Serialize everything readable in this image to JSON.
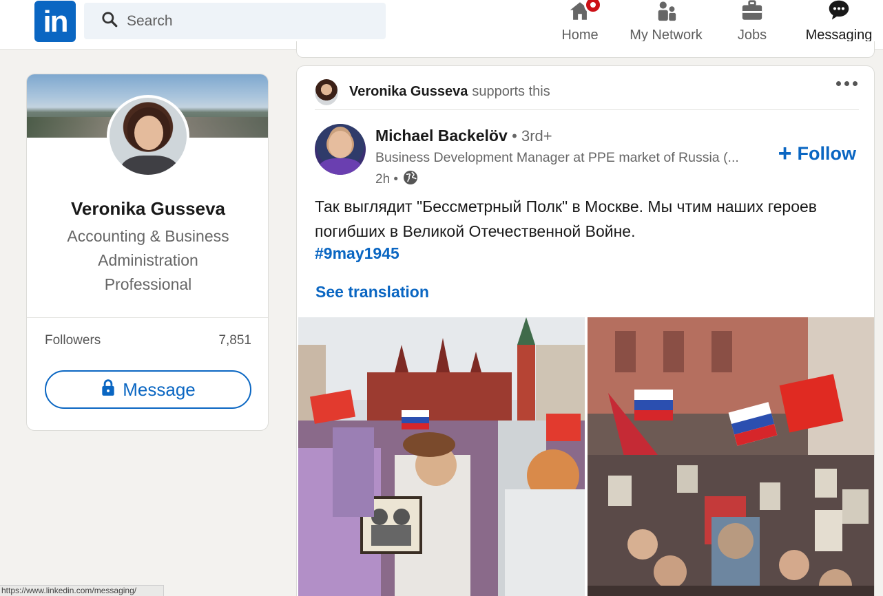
{
  "nav": {
    "logo_text": "in",
    "search": {
      "placeholder": "Search",
      "value": ""
    },
    "items": [
      {
        "label": "Home",
        "icon": "home-icon",
        "has_badge": true
      },
      {
        "label": "My Network",
        "icon": "network-icon"
      },
      {
        "label": "Jobs",
        "icon": "briefcase-icon"
      },
      {
        "label": "Messaging",
        "icon": "messaging-icon"
      }
    ]
  },
  "profile": {
    "name": "Veronika Gusseva",
    "headline": "Accounting & Business Administration Professional",
    "followers_label": "Followers",
    "followers_count": "7,851",
    "message_label": "Message"
  },
  "post": {
    "supporter_name": "Veronika Gusseva",
    "supporter_action": "supports this",
    "author": {
      "name": "Michael Backelöv",
      "degree": "• 3rd+",
      "headline": "Business Development Manager at PPE market of Russia (...",
      "time": "2h •"
    },
    "follow_label": "Follow",
    "text": "Так выглядит \"Бессметрный Полк\" в Москве. Мы чтим наших героев погибших в Великой Отечественной Войне.",
    "hashtag": "#9may1945",
    "see_translation": "See translation"
  },
  "status_bar": {
    "url": "https://www.linkedin.com/messaging/"
  },
  "colors": {
    "brand": "#0a66c2",
    "background": "#f3f2ef",
    "badge": "#cc1016"
  }
}
